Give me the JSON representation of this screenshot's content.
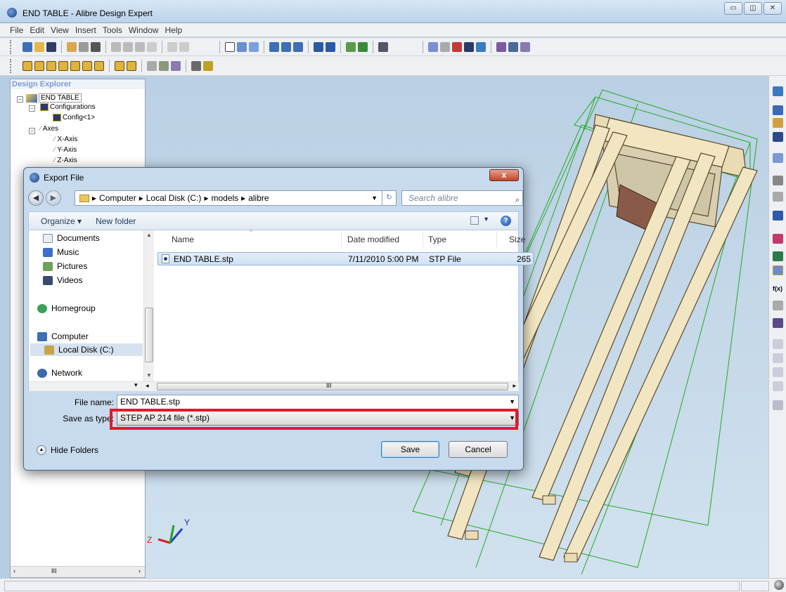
{
  "window": {
    "title": "END TABLE - Alibre Design Expert",
    "controls": [
      "minimize-icon",
      "restore-icon",
      "close-icon"
    ]
  },
  "menu": [
    "File",
    "Edit",
    "View",
    "Insert",
    "Tools",
    "Window",
    "Help"
  ],
  "explorer": {
    "header": "Design Explorer",
    "tree": [
      {
        "label": "END TABLE",
        "icon": "part-icon"
      },
      {
        "label": "Configurations",
        "icon": "table-icon"
      },
      {
        "label": "Config<1>",
        "icon": "table-icon"
      },
      {
        "label": "Axes",
        "icon": "axis-icon"
      },
      {
        "label": "X-Axis",
        "icon": "axis-icon"
      },
      {
        "label": "Y-Axis",
        "icon": "axis-icon"
      },
      {
        "label": "Z-Axis",
        "icon": "axis-icon"
      }
    ],
    "scroll_mid": "III"
  },
  "viewport": {
    "triad": {
      "y": "Y",
      "z": "Z"
    },
    "colors": {
      "bg_top": "#bad0e4",
      "wood": "#f2e6c2",
      "edge": "#5a4a2a",
      "bbox": "#22aa22",
      "block": "#8a5a48"
    }
  },
  "dialog": {
    "title": "Export File",
    "close_label": "x",
    "breadcrumb": [
      "Computer",
      "Local Disk (C:)",
      "models",
      "alibre"
    ],
    "search_placeholder": "Search alibre",
    "organize": "Organize ▾",
    "new_folder": "New folder",
    "nav": [
      {
        "label": "Documents",
        "icon": "documents-icon",
        "color": "#e8eef6"
      },
      {
        "label": "Music",
        "icon": "music-icon",
        "color": "#3b6fd1"
      },
      {
        "label": "Pictures",
        "icon": "pictures-icon",
        "color": "#6fa15b"
      },
      {
        "label": "Videos",
        "icon": "videos-icon",
        "color": "#3a4a6a"
      },
      {
        "label": "Homegroup",
        "icon": "homegroup-icon",
        "color": "#3aa05a"
      },
      {
        "label": "Computer",
        "icon": "computer-icon",
        "color": "#3c6fb4"
      },
      {
        "label": "Local Disk (C:)",
        "icon": "disk-icon",
        "color": "#c9a24a"
      },
      {
        "label": "Network",
        "icon": "network-icon",
        "color": "#3a6aa8"
      }
    ],
    "columns": {
      "name": "Name",
      "date": "Date modified",
      "type": "Type",
      "size": "Size"
    },
    "files": [
      {
        "name": "END TABLE.stp",
        "date": "7/11/2010 5:00 PM",
        "type": "STP File",
        "size": "265"
      }
    ],
    "scroll_mid": "III",
    "file_name_label": "File name:",
    "file_name_value": "END TABLE.stp",
    "save_type_label": "Save as type:",
    "save_type_value": "STEP AP 214 file (*.stp)",
    "hide_folders": "Hide Folders",
    "save_label": "Save",
    "cancel_label": "Cancel"
  }
}
